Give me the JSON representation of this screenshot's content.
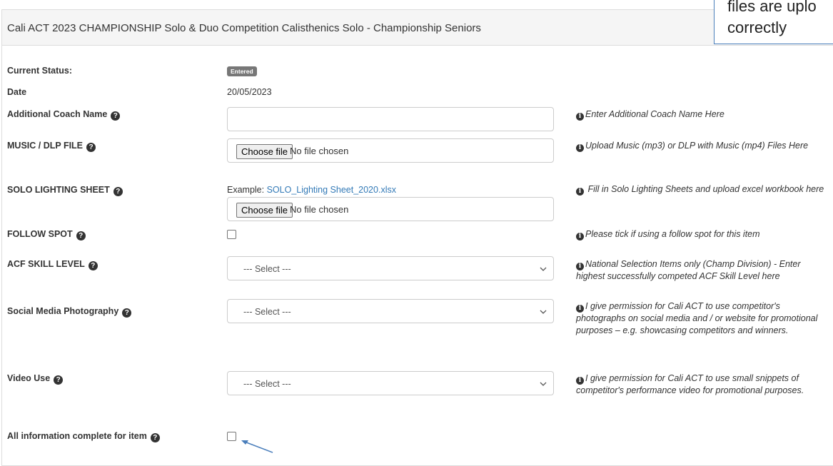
{
  "panel": {
    "title": "Cali ACT 2023 CHAMPIONSHIP Solo & Duo Competition Calisthenics Solo - Championship Seniors"
  },
  "callout": {
    "line1": "files are uplo",
    "line2": "correctly"
  },
  "status": {
    "label": "Current Status:",
    "badge": "Entered"
  },
  "date": {
    "label": "Date",
    "value": "20/05/2023"
  },
  "coach": {
    "label": "Additional Coach Name",
    "value": "",
    "help": "Enter Additional Coach Name Here"
  },
  "music": {
    "label": "MUSIC / DLP FILE",
    "button": "Choose file",
    "file": "No file chosen",
    "help": "Upload Music (mp3) or DLP with Music (mp4) Files Here"
  },
  "lighting": {
    "label": "SOLO LIGHTING SHEET",
    "example_prefix": "Example: ",
    "example_link": "SOLO_Lighting Sheet_2020.xlsx",
    "button": "Choose file",
    "file": "No file chosen",
    "help": " Fill in Solo Lighting Sheets and upload excel workbook here"
  },
  "followspot": {
    "label": "FOLLOW SPOT",
    "checked": false,
    "help": "Please tick if using a follow spot for this item"
  },
  "skill": {
    "label": "ACF SKILL LEVEL",
    "selected": "--- Select ---",
    "help": "National Selection Items only (Champ Division) - Enter highest successfully competed ACF Skill Level here"
  },
  "social": {
    "label": "Social Media Photography",
    "selected": "--- Select ---",
    "help": "I give permission for Cali ACT to use competitor's photographs on social media and / or website for promotional purposes – e.g. showcasing competitors and winners."
  },
  "video": {
    "label": "Video Use",
    "selected": "--- Select ---",
    "help": "I give permission for Cali ACT to use small snippets of competitor's performance video for promotional purposes."
  },
  "complete": {
    "label": "All information complete for item",
    "checked": false
  },
  "icons": {
    "question": "?",
    "info": "i"
  },
  "colors": {
    "link": "#337ab7",
    "badge": "#777777",
    "annotation": "#4a7ebb"
  }
}
